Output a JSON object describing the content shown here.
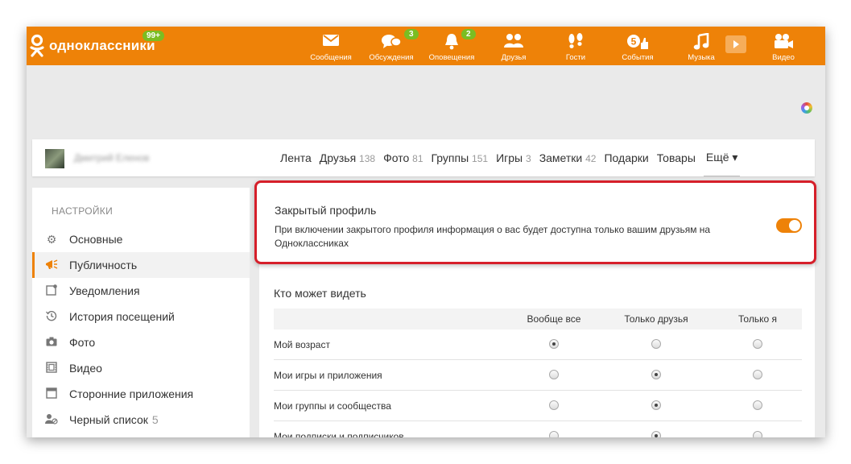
{
  "brand": {
    "name": "одноклассники",
    "badge": "99+",
    "color": "#ee8208"
  },
  "nav": [
    {
      "label": "Сообщения",
      "icon": "envelope-icon",
      "badge": ""
    },
    {
      "label": "Обсуждения",
      "icon": "chat-bubbles-icon",
      "badge": "3"
    },
    {
      "label": "Оповещения",
      "icon": "bell-icon",
      "badge": "2"
    },
    {
      "label": "Друзья",
      "icon": "friends-icon",
      "badge": ""
    },
    {
      "label": "Гости",
      "icon": "footprints-icon",
      "badge": ""
    },
    {
      "label": "События",
      "icon": "events-icon",
      "badge": ""
    },
    {
      "label": "Музыка",
      "icon": "music-note-icon",
      "badge": ""
    },
    {
      "label": "Видео",
      "icon": "video-camera-icon",
      "badge": ""
    }
  ],
  "events_icon_number": "5",
  "profile": {
    "name": "Дмитрий Еленов",
    "tabs": [
      {
        "label": "Лента",
        "count": ""
      },
      {
        "label": "Друзья",
        "count": "138"
      },
      {
        "label": "Фото",
        "count": "81"
      },
      {
        "label": "Группы",
        "count": "151"
      },
      {
        "label": "Игры",
        "count": "3"
      },
      {
        "label": "Заметки",
        "count": "42"
      },
      {
        "label": "Подарки",
        "count": ""
      },
      {
        "label": "Товары",
        "count": ""
      }
    ],
    "more_label": "Ещё ▾"
  },
  "sidebar": {
    "heading": "НАСТРОЙКИ",
    "items": [
      {
        "label": "Основные",
        "icon": "gear-icon",
        "count": ""
      },
      {
        "label": "Публичность",
        "icon": "megaphone-icon",
        "count": "",
        "active": true
      },
      {
        "label": "Уведомления",
        "icon": "notification-icon",
        "count": ""
      },
      {
        "label": "История посещений",
        "icon": "history-icon",
        "count": ""
      },
      {
        "label": "Фото",
        "icon": "camera-icon",
        "count": ""
      },
      {
        "label": "Видео",
        "icon": "film-icon",
        "count": ""
      },
      {
        "label": "Сторонние приложения",
        "icon": "apps-window-icon",
        "count": ""
      },
      {
        "label": "Черный список",
        "icon": "blocked-user-icon",
        "count": "5"
      }
    ]
  },
  "closed_profile": {
    "title": "Закрытый профиль",
    "description": "При включении закрытого профиля информация о вас будет доступна только вашим друзьям на Одноклассниках",
    "enabled": true
  },
  "privacy": {
    "title": "Кто может видеть",
    "columns": [
      "Вообще все",
      "Только друзья",
      "Только я"
    ],
    "rows": [
      {
        "label": "Мой возраст",
        "selected": 0
      },
      {
        "label": "Мои игры и приложения",
        "selected": 1
      },
      {
        "label": "Мои группы и сообщества",
        "selected": 1
      },
      {
        "label": "Мои подписки и подписчиков",
        "selected": 1
      }
    ]
  }
}
